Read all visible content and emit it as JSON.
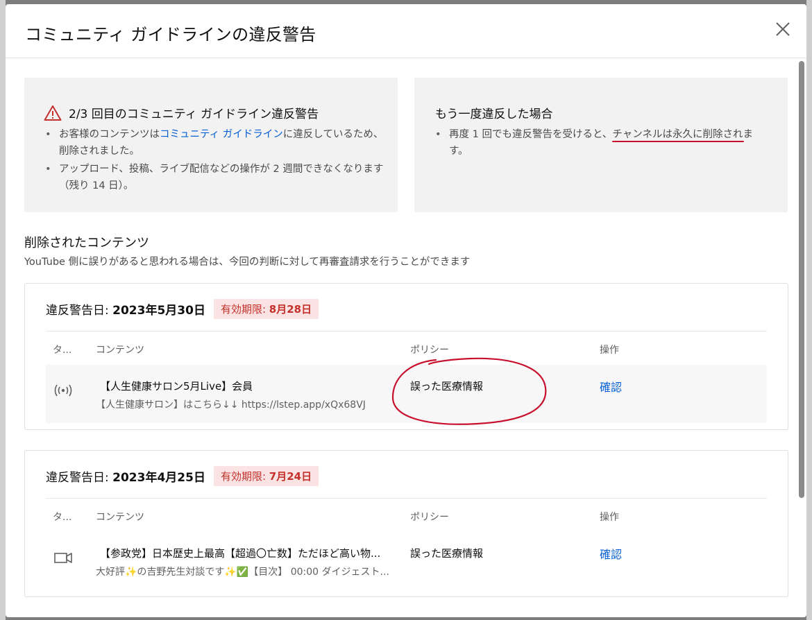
{
  "dialog": {
    "title": "コミュニティ ガイドラインの違反警告"
  },
  "strike_panel": {
    "title": "2/3 回目のコミュニティ ガイドライン違反警告",
    "bullet1_pre": "お客様のコンテンツは",
    "bullet1_link": "コミュニティ ガイドライン",
    "bullet1_post": "に違反しているため、削除されました。",
    "bullet2": "アップロード、投稿、ライブ配信などの操作が 2 週間できなくなります（残り 14 日）。"
  },
  "next_panel": {
    "title": "もう一度違反した場合",
    "bullet_pre": "再度 1 回でも違反警告を受けると、",
    "bullet_underlined": "チャンネルは永久に削除され",
    "bullet_post": "ます。"
  },
  "removed": {
    "title": "削除されたコンテンツ",
    "subtitle": "YouTube 側に誤りがあると思われる場合は、今回の判断に対して再審査請求を行うことができます"
  },
  "table_headers": {
    "type": "タ...",
    "content": "コンテンツ",
    "policy": "ポリシー",
    "action": "操作"
  },
  "strikes": [
    {
      "date_label": "違反警告日:",
      "date": "2023年5月30日",
      "expiry_label": "有効期限:",
      "expiry": "8月28日",
      "type_icon": "live-broadcast-icon",
      "content_title": "【人生健康サロン5月Live】会員",
      "content_desc": "【人生健康サロン】はこちら↓↓ https://lstep.app/xQx68VJ",
      "policy": "誤った医療情報",
      "action": "確認"
    },
    {
      "date_label": "違反警告日:",
      "date": "2023年4月25日",
      "expiry_label": "有効期限:",
      "expiry": "7月24日",
      "type_icon": "video-camera-icon",
      "content_title": "【参政党】日本歴史上最高【超過〇亡数】ただほど高い物...",
      "content_desc": "大好評✨の吉野先生対談です✨✅【目次】 00:00 ダイジェスト...",
      "policy": "誤った医療情報",
      "action": "確認"
    }
  ],
  "colors": {
    "link": "#065fd4",
    "expiry_bg": "#fbe3e3",
    "expiry_text": "#c4302b",
    "annotation_red": "#c8102e"
  }
}
